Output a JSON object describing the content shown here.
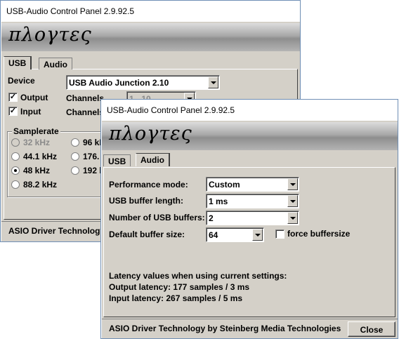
{
  "back_window": {
    "title": "USB-Audio Control Panel 2.9.92.5",
    "logo": "πλογτες",
    "tabs": [
      {
        "label": "USB"
      },
      {
        "label": "Audio"
      }
    ],
    "device_label": "Device",
    "device_value": "USB Audio Junction 2.10",
    "output_label": "Output",
    "input_label": "Input",
    "channels_label": "Channels",
    "channels_value": "1 - 10",
    "samplerate_title": "Samplerate",
    "rates": [
      "32 kHz",
      "44.1 kHz",
      "48 kHz",
      "88.2 kHz",
      "96 kHz",
      "176.",
      "192 k"
    ],
    "selected_rate": "48 kHz",
    "footer": "ASIO Driver Technology"
  },
  "front_window": {
    "title": "USB-Audio Control Panel 2.9.92.5",
    "logo": "πλογτες",
    "tabs": [
      {
        "label": "USB"
      },
      {
        "label": "Audio"
      }
    ],
    "performance_label": "Performance mode:",
    "performance_value": "Custom",
    "buffer_length_label": "USB buffer length:",
    "buffer_length_value": "1 ms",
    "num_buffers_label": "Number of USB buffers:",
    "num_buffers_value": "2",
    "default_buffer_label": "Default buffer size:",
    "default_buffer_value": "64",
    "force_label": "force buffersize",
    "latency_heading": "Latency values when using current settings:",
    "output_latency": "Output latency: 177 samples / 3 ms",
    "input_latency": "Input latency: 267 samples / 5 ms",
    "footer": "ASIO Driver Technology by Steinberg Media Technologies",
    "close_label": "Close"
  },
  "colors": {
    "window_border": "#6f8fb5",
    "face": "#d4d0c8"
  }
}
